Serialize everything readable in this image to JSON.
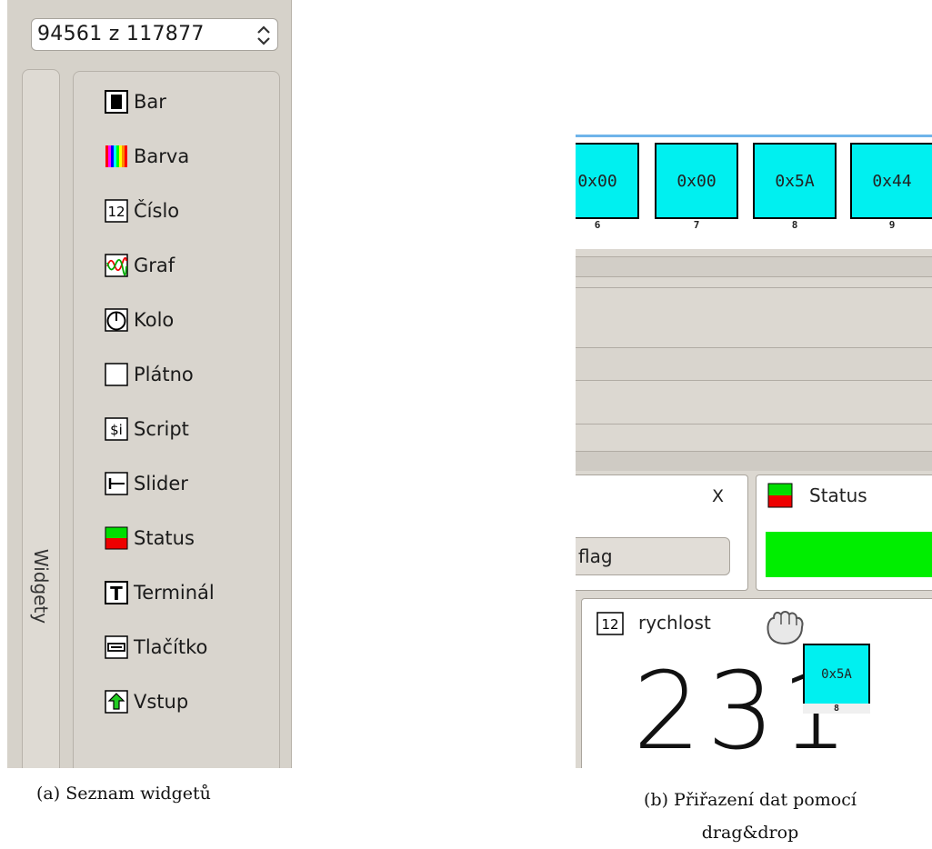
{
  "panel_a": {
    "spinbox": {
      "value": "94561 z 117877"
    },
    "tab_label": "Widgety",
    "widgets": [
      {
        "label": "Bar",
        "icon": "bar-icon"
      },
      {
        "label": "Barva",
        "icon": "color-icon"
      },
      {
        "label": "Číslo",
        "icon": "number-icon",
        "icon_text": "12"
      },
      {
        "label": "Graf",
        "icon": "graph-icon"
      },
      {
        "label": "Kolo",
        "icon": "circle-icon"
      },
      {
        "label": "Plátno",
        "icon": "canvas-icon"
      },
      {
        "label": "Script",
        "icon": "script-icon",
        "icon_text": "$i"
      },
      {
        "label": "Slider",
        "icon": "slider-icon"
      },
      {
        "label": "Status",
        "icon": "status-icon"
      },
      {
        "label": "Terminál",
        "icon": "terminal-icon",
        "icon_text": "T"
      },
      {
        "label": "Tlačítko",
        "icon": "button-icon"
      },
      {
        "label": "Vstup",
        "icon": "input-icon"
      }
    ],
    "caption": "(a) Seznam widgetů"
  },
  "panel_b": {
    "hex_cells": [
      {
        "value": "0x00",
        "index": "6"
      },
      {
        "value": "0x00",
        "index": "7"
      },
      {
        "value": "0x5A",
        "index": "8"
      },
      {
        "value": "0x44",
        "index": "9"
      }
    ],
    "left_pane": {
      "close_label": "X",
      "button_label": "flag"
    },
    "status_pane": {
      "title": "Status",
      "bar_color": "#00ee00"
    },
    "speed_pane": {
      "icon_text": "12",
      "title": "rychlost",
      "value": "231"
    },
    "drag_cell": {
      "value": "0x5A",
      "index": "8"
    },
    "caption_line1": "(b) Přiřazení dat pomocí",
    "caption_line2": "drag&drop"
  },
  "colors": {
    "hex_cell": "#00f0f0",
    "status_green": "#00ee00",
    "panel_bg": "#d6d2ca",
    "accent_blue": "#6fb4ea"
  }
}
